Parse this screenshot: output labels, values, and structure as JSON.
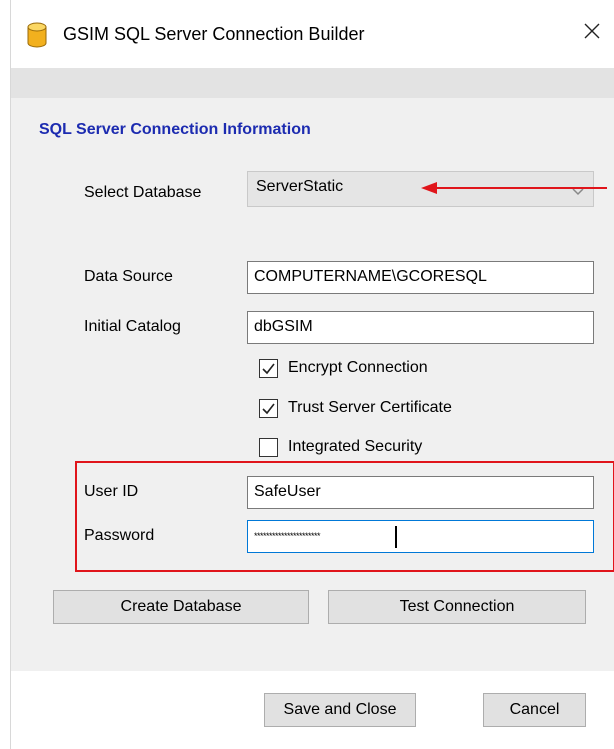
{
  "window": {
    "title": "GSIM SQL Server Connection Builder",
    "close_glyph": "✕"
  },
  "section": {
    "title": "SQL Server Connection Information"
  },
  "select_database": {
    "label": "Select Database",
    "value": "ServerStatic"
  },
  "data_source": {
    "label": "Data Source",
    "value": "COMPUTERNAME\\GCORESQL"
  },
  "initial_catalog": {
    "label": "Initial Catalog",
    "value": "dbGSIM"
  },
  "checkboxes": [
    {
      "label": "Encrypt Connection",
      "checked": true
    },
    {
      "label": "Trust Server Certificate",
      "checked": true
    },
    {
      "label": "Integrated Security",
      "checked": false
    }
  ],
  "user_id": {
    "label": "User ID",
    "value": "SafeUser"
  },
  "password": {
    "label": "Password",
    "value": "**********************"
  },
  "buttons": {
    "create_database": "Create Database",
    "test_connection": "Test Connection",
    "save_and_close": "Save and Close",
    "cancel": "Cancel"
  },
  "colors": {
    "section_title": "#1c2bb0",
    "annotation_red": "#e0151b",
    "focus_border": "#0078d7"
  },
  "icons": {
    "app": "database-cylinder-icon",
    "close": "close-icon",
    "dropdown": "chevron-down-icon",
    "checkmark": "checkmark-icon"
  }
}
